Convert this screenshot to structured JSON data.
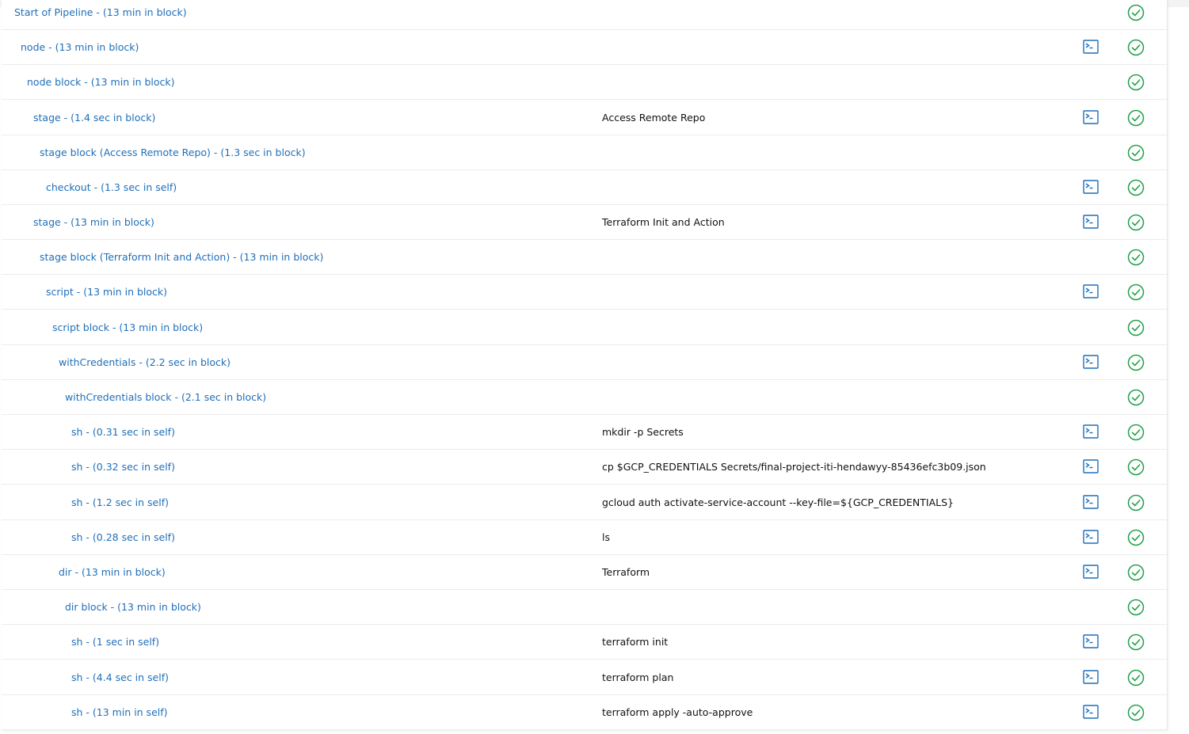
{
  "colors": {
    "link": "#1f6fb9",
    "success": "#20a04a",
    "console": "#1f6fb9"
  },
  "icons": {
    "console": "terminal-console-icon",
    "status": "success-check-circle-icon"
  },
  "steps": [
    {
      "label": "Start of Pipeline - (13 min in block)",
      "args": "",
      "console": false,
      "status": "success"
    },
    {
      "label": "node - (13 min in block)",
      "args": "",
      "console": true,
      "status": "success"
    },
    {
      "label": "node block - (13 min in block)",
      "args": "",
      "console": false,
      "status": "success"
    },
    {
      "label": "stage - (1.4 sec in block)",
      "args": "Access Remote Repo",
      "console": true,
      "status": "success"
    },
    {
      "label": "stage block (Access Remote Repo) - (1.3 sec in block)",
      "args": "",
      "console": false,
      "status": "success"
    },
    {
      "label": "checkout - (1.3 sec in self)",
      "args": "",
      "console": true,
      "status": "success"
    },
    {
      "label": "stage - (13 min in block)",
      "args": "Terraform Init and Action",
      "console": true,
      "status": "success"
    },
    {
      "label": "stage block (Terraform Init and Action) - (13 min in block)",
      "args": "",
      "console": false,
      "status": "success"
    },
    {
      "label": "script - (13 min in block)",
      "args": "",
      "console": true,
      "status": "success"
    },
    {
      "label": "script block - (13 min in block)",
      "args": "",
      "console": false,
      "status": "success"
    },
    {
      "label": "withCredentials - (2.2 sec in block)",
      "args": "",
      "console": true,
      "status": "success"
    },
    {
      "label": "withCredentials block - (2.1 sec in block)",
      "args": "",
      "console": false,
      "status": "success"
    },
    {
      "label": "sh - (0.31 sec in self)",
      "args": "mkdir -p Secrets",
      "console": true,
      "status": "success"
    },
    {
      "label": "sh - (0.32 sec in self)",
      "args": "cp $GCP_CREDENTIALS Secrets/final-project-iti-hendawyy-85436efc3b09.json",
      "console": true,
      "status": "success"
    },
    {
      "label": "sh - (1.2 sec in self)",
      "args": "gcloud auth activate-service-account --key-file=${GCP_CREDENTIALS}",
      "console": true,
      "status": "success"
    },
    {
      "label": "sh - (0.28 sec in self)",
      "args": "ls",
      "console": true,
      "status": "success"
    },
    {
      "label": "dir - (13 min in block)",
      "args": "Terraform",
      "console": true,
      "status": "success"
    },
    {
      "label": "dir block - (13 min in block)",
      "args": "",
      "console": false,
      "status": "success"
    },
    {
      "label": "sh - (1 sec in self)",
      "args": "terraform init",
      "console": true,
      "status": "success"
    },
    {
      "label": "sh - (4.4 sec in self)",
      "args": "terraform plan",
      "console": true,
      "status": "success"
    },
    {
      "label": "sh - (13 min in self)",
      "args": "terraform apply -auto-approve",
      "console": true,
      "status": "success"
    }
  ]
}
